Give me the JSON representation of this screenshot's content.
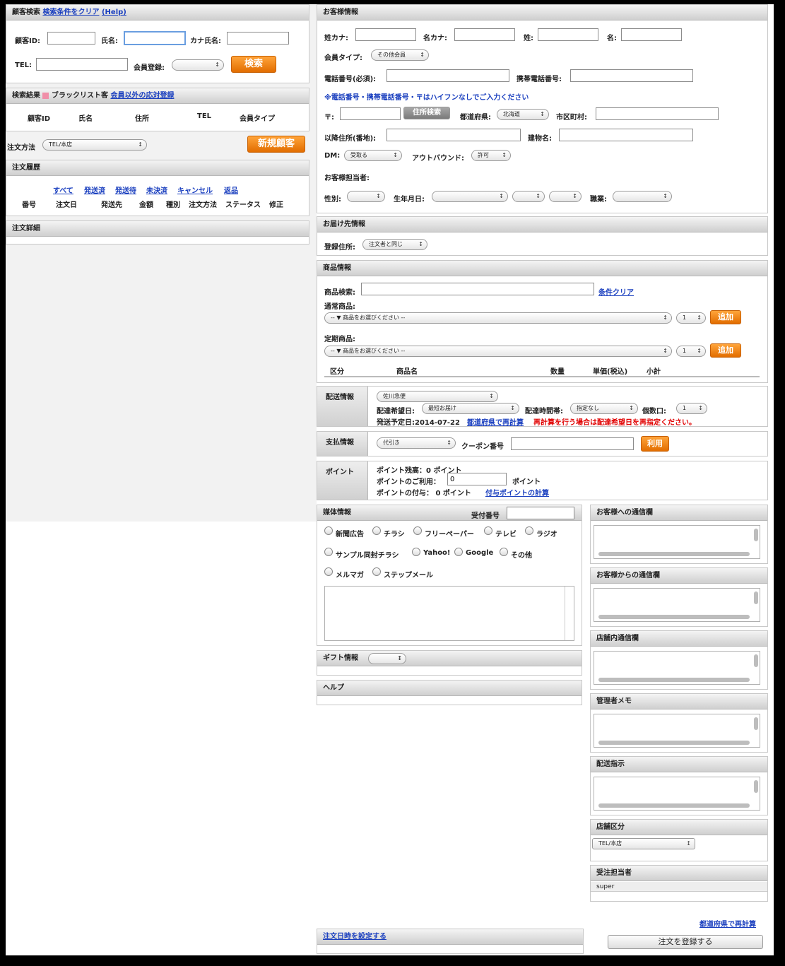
{
  "customer_search": {
    "title": "顧客検索",
    "clear_link": "検索条件をクリア",
    "help_link": "(Help)",
    "id_label": "顧客ID:",
    "name_label": "氏名:",
    "kana_label": "カナ氏名:",
    "tel_label": "TEL:",
    "member_label": "会員登録:",
    "search_button": "検索"
  },
  "search_results": {
    "title": "検索結果",
    "blacklist_label": "ブラックリスト客",
    "non_member_link": "会員以外の応対登録",
    "columns": [
      "顧客ID",
      "氏名",
      "住所",
      "TEL",
      "会員タイプ"
    ]
  },
  "order_method": {
    "label": "注文方法",
    "value": "TEL/本店",
    "new_customer_button": "新規顧客"
  },
  "order_history": {
    "title": "注文履歴",
    "filters": [
      "すべて",
      "発送済",
      "発送待",
      "未決済",
      "キャンセル",
      "返品"
    ],
    "columns": [
      "番号",
      "注文日",
      "発送先",
      "金額",
      "種別",
      "注文方法",
      "ステータス",
      "修正"
    ]
  },
  "order_detail": {
    "title": "注文詳細"
  },
  "customer_info": {
    "title": "お客様情報",
    "sei_kana": "姓カナ:",
    "mei_kana": "名カナ:",
    "sei": "姓:",
    "mei": "名:",
    "member_type_label": "会員タイプ:",
    "member_type_value": "その他会員",
    "phone_label": "電話番号(必須):",
    "mobile_label": "携帯電話番号:",
    "notice": "※電話番号・携帯電話番号・〒はハイフンなしでご入力ください",
    "zip_label": "〒:",
    "address_search_button": "住所検索",
    "pref_label": "都道府県:",
    "pref_value": "北海道",
    "city_label": "市区町村:",
    "address_label": "以降住所(番地):",
    "building_label": "建物名:",
    "dm_label": "DM:",
    "dm_value": "受取る",
    "outbound_label": "アウトバウンド:",
    "outbound_value": "許可",
    "staff_label": "お客様担当者:",
    "gender_label": "性別:",
    "birthday_label": "生年月日:",
    "job_label": "職業:"
  },
  "delivery_dest": {
    "title": "お届け先情報",
    "registered_label": "登録住所:",
    "registered_value": "注文者と同じ"
  },
  "product_info": {
    "title": "商品情報",
    "search_label": "商品検索:",
    "clear_link": "条件クリア",
    "normal_label": "通常商品:",
    "regular_label": "定期商品:",
    "select_placeholder": "-- ▼ 商品をお選びください --",
    "qty_value": "1",
    "add_button": "追加",
    "columns": [
      "区分",
      "商品名",
      "数量",
      "単価(税込)",
      "小計"
    ]
  },
  "shipping": {
    "title": "配送情報",
    "carrier": "佐川急便",
    "date_label": "配達希望日:",
    "date_value": "最短お届け",
    "time_label": "配達時間帯:",
    "time_value": "指定なし",
    "count_label": "個数口:",
    "count_value": "1",
    "scheduled": "発送予定日:2014-07-22",
    "recalc_link": "都道府県で再計算",
    "warning": "再計算を行う場合は配達希望日を再指定ください。"
  },
  "payment": {
    "title": "支払情報",
    "method": "代引き",
    "coupon_label": "クーポン番号",
    "use_button": "利用"
  },
  "points": {
    "title": "ポイント",
    "balance": "ポイント残高：0 ポイント",
    "use_label": "ポイントのご利用：",
    "use_value": "0",
    "use_unit": "ポイント",
    "grant": "ポイントの付与： 0 ポイント",
    "calc_link": "付与ポイントの計算"
  },
  "media": {
    "title": "媒体情報",
    "receipt_label": "受付番号",
    "options": [
      "新聞広告",
      "チラシ",
      "フリーペーパー",
      "テレビ",
      "ラジオ",
      "サンプル同封チラシ",
      "Yahoo!",
      "Google",
      "その他",
      "メルマガ",
      "ステップメール"
    ]
  },
  "gift": {
    "title": "ギフト情報"
  },
  "help": {
    "title": "ヘルプ"
  },
  "side": {
    "to_customer": "お客様への通信欄",
    "from_customer": "お客様からの通信欄",
    "internal": "店舗内通信欄",
    "admin_memo": "管理者メモ",
    "delivery_instr": "配送指示",
    "store_label": "店舗区分",
    "store_value": "TEL/本店",
    "staff_label": "受注担当者",
    "staff_value": "super"
  },
  "footer": {
    "set_datetime_link": "注文日時を設定する",
    "recalc_link": "都道府県で再計算",
    "register_button": "注文を登録する"
  }
}
